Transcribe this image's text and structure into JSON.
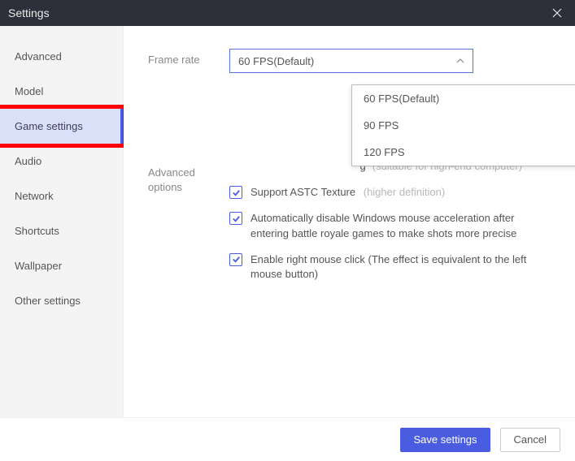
{
  "titlebar": {
    "title": "Settings"
  },
  "sidebar": {
    "items": [
      {
        "label": "Advanced"
      },
      {
        "label": "Model"
      },
      {
        "label": "Game settings"
      },
      {
        "label": "Audio"
      },
      {
        "label": "Network"
      },
      {
        "label": "Shortcuts"
      },
      {
        "label": "Wallpaper"
      },
      {
        "label": "Other settings"
      }
    ],
    "activeIndex": 2
  },
  "main": {
    "frame_rate_label": "Frame rate",
    "frame_rate_value": "60 FPS(Default)",
    "frame_rate_options": [
      "60 FPS(Default)",
      "90 FPS",
      "120 FPS"
    ],
    "advanced_label": "Advanced options",
    "obscured_option_tail": "g",
    "obscured_option_hint": "(suitable for high-end computer)",
    "astc_label": "Support ASTC Texture",
    "astc_hint": "(higher definition)",
    "mouse_accel_label": "Automatically disable Windows mouse acceleration after entering battle royale games to make shots more precise",
    "right_click_label": "Enable right mouse click (The effect is equivalent to the left mouse button)"
  },
  "footer": {
    "save": "Save settings",
    "cancel": "Cancel"
  }
}
